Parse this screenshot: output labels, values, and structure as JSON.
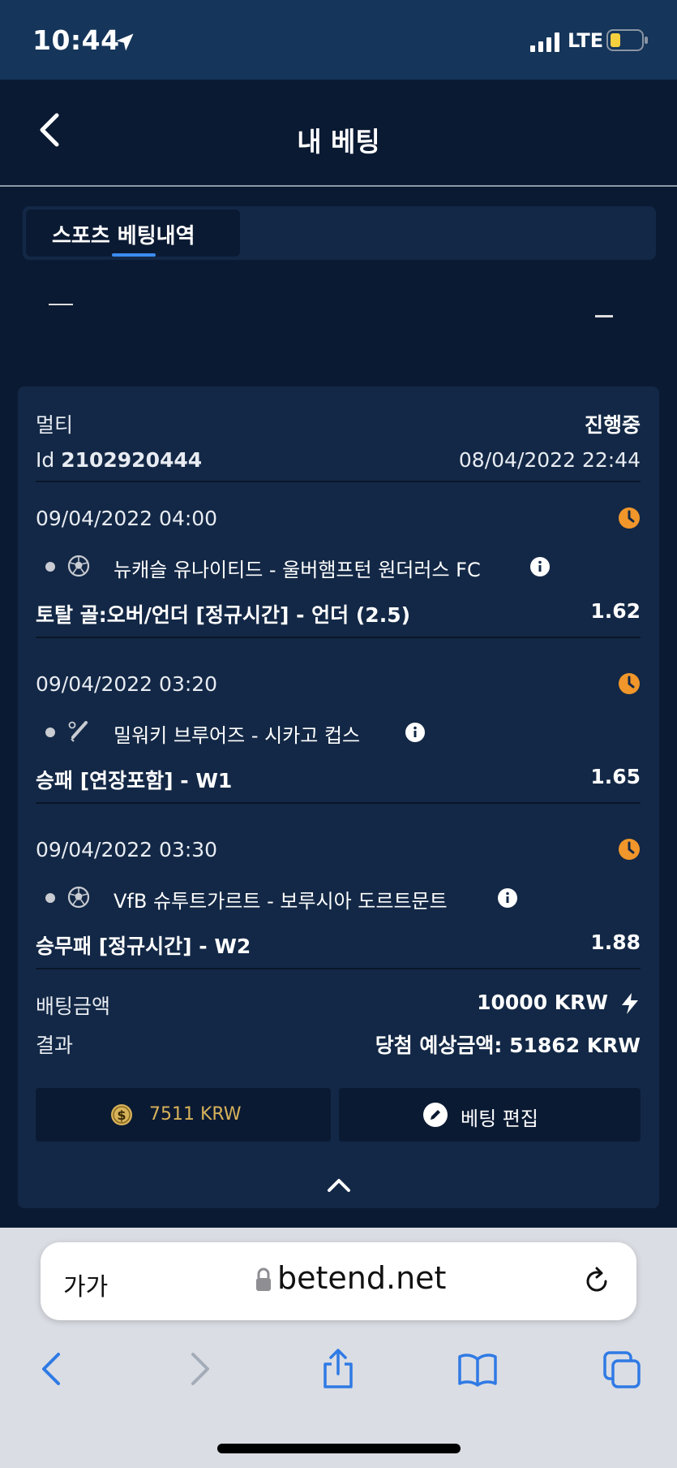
{
  "status_bar": {
    "time": "10:44",
    "network": "LTE"
  },
  "header": {
    "title": "내 베팅"
  },
  "tabs": [
    {
      "label": "스포츠 베팅내역"
    }
  ],
  "bet": {
    "type": "멀티",
    "status": "진행중",
    "id_label": "Id",
    "id_value": "2102920444",
    "placed_at": "08/04/2022 22:44",
    "selections": [
      {
        "datetime": "09/04/2022 04:00",
        "sport_icon": "soccer-ball-icon",
        "match": "뉴캐슬 유나이티드 - 울버햄프턴 원더러스 FC",
        "market": "토탈 골:오버/언더 [정규시간] - 언더 (2.5)",
        "odds": "1.62"
      },
      {
        "datetime": "09/04/2022 03:20",
        "sport_icon": "baseball-icon",
        "match": "밀워키 브루어즈 - 시카고 컵스",
        "market": "승패 [연장포함] - W1",
        "odds": "1.65"
      },
      {
        "datetime": "09/04/2022 03:30",
        "sport_icon": "soccer-ball-icon",
        "match": "VfB 슈투트가르트 - 보루시아 도르트문트",
        "market": "승무패 [정규시간] - W2",
        "odds": "1.88"
      }
    ],
    "stake_label": "배팅금액",
    "stake_value": "10000 KRW",
    "result_label": "결과",
    "result_value": "당첨 예상금액: 51862 KRW",
    "balance_value": "7511  KRW",
    "edit_label": "베팅 편집"
  },
  "browser": {
    "text_size": "가가",
    "url": "betend.net"
  },
  "colors": {
    "background": "#0b1a33",
    "card": "#132846",
    "accent_blue": "#3c8cf0",
    "clock_orange": "#f0962a",
    "coin_gold": "#d7b25a"
  }
}
